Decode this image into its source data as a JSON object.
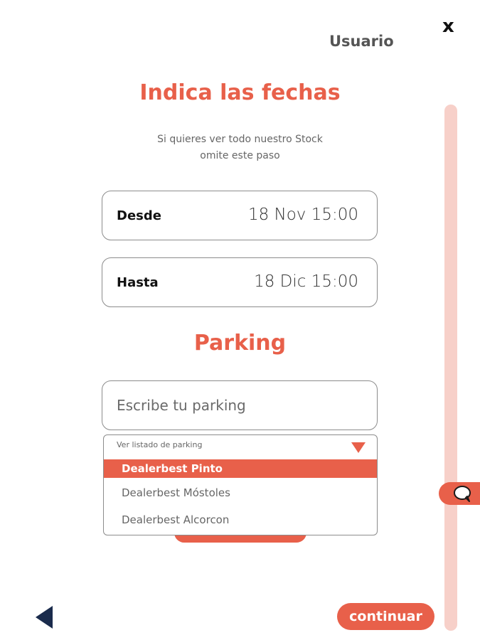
{
  "header": {
    "close_label": "x",
    "user_label": "Usuario"
  },
  "dates": {
    "title": "Indica las fechas",
    "subtitle_line1": "Si quieres ver todo nuestro Stock",
    "subtitle_line2": "omite este paso",
    "from_label": "Desde",
    "from_value": "18 Nov 15:00",
    "to_label": "Hasta",
    "to_value": "18 Dic 15:00"
  },
  "parking": {
    "title": "Parking",
    "input_placeholder": "Escribe tu parking",
    "dropdown_label": "Ver listado de parking",
    "options": [
      {
        "label": "Dealerbest Pinto",
        "selected": true
      },
      {
        "label": "Dealerbest Móstoles",
        "selected": false
      },
      {
        "label": "Dealerbest Alcorcon",
        "selected": false
      }
    ]
  },
  "footer": {
    "continue_label": "continuar"
  },
  "icons": {
    "close": "close-icon",
    "chat": "chat-bubble-icon",
    "back": "back-triangle-icon",
    "dropdown": "triangle-down-icon"
  },
  "colors": {
    "accent": "#e8604a",
    "accent_light": "#f7d0c9",
    "navy": "#1a2b4c"
  }
}
